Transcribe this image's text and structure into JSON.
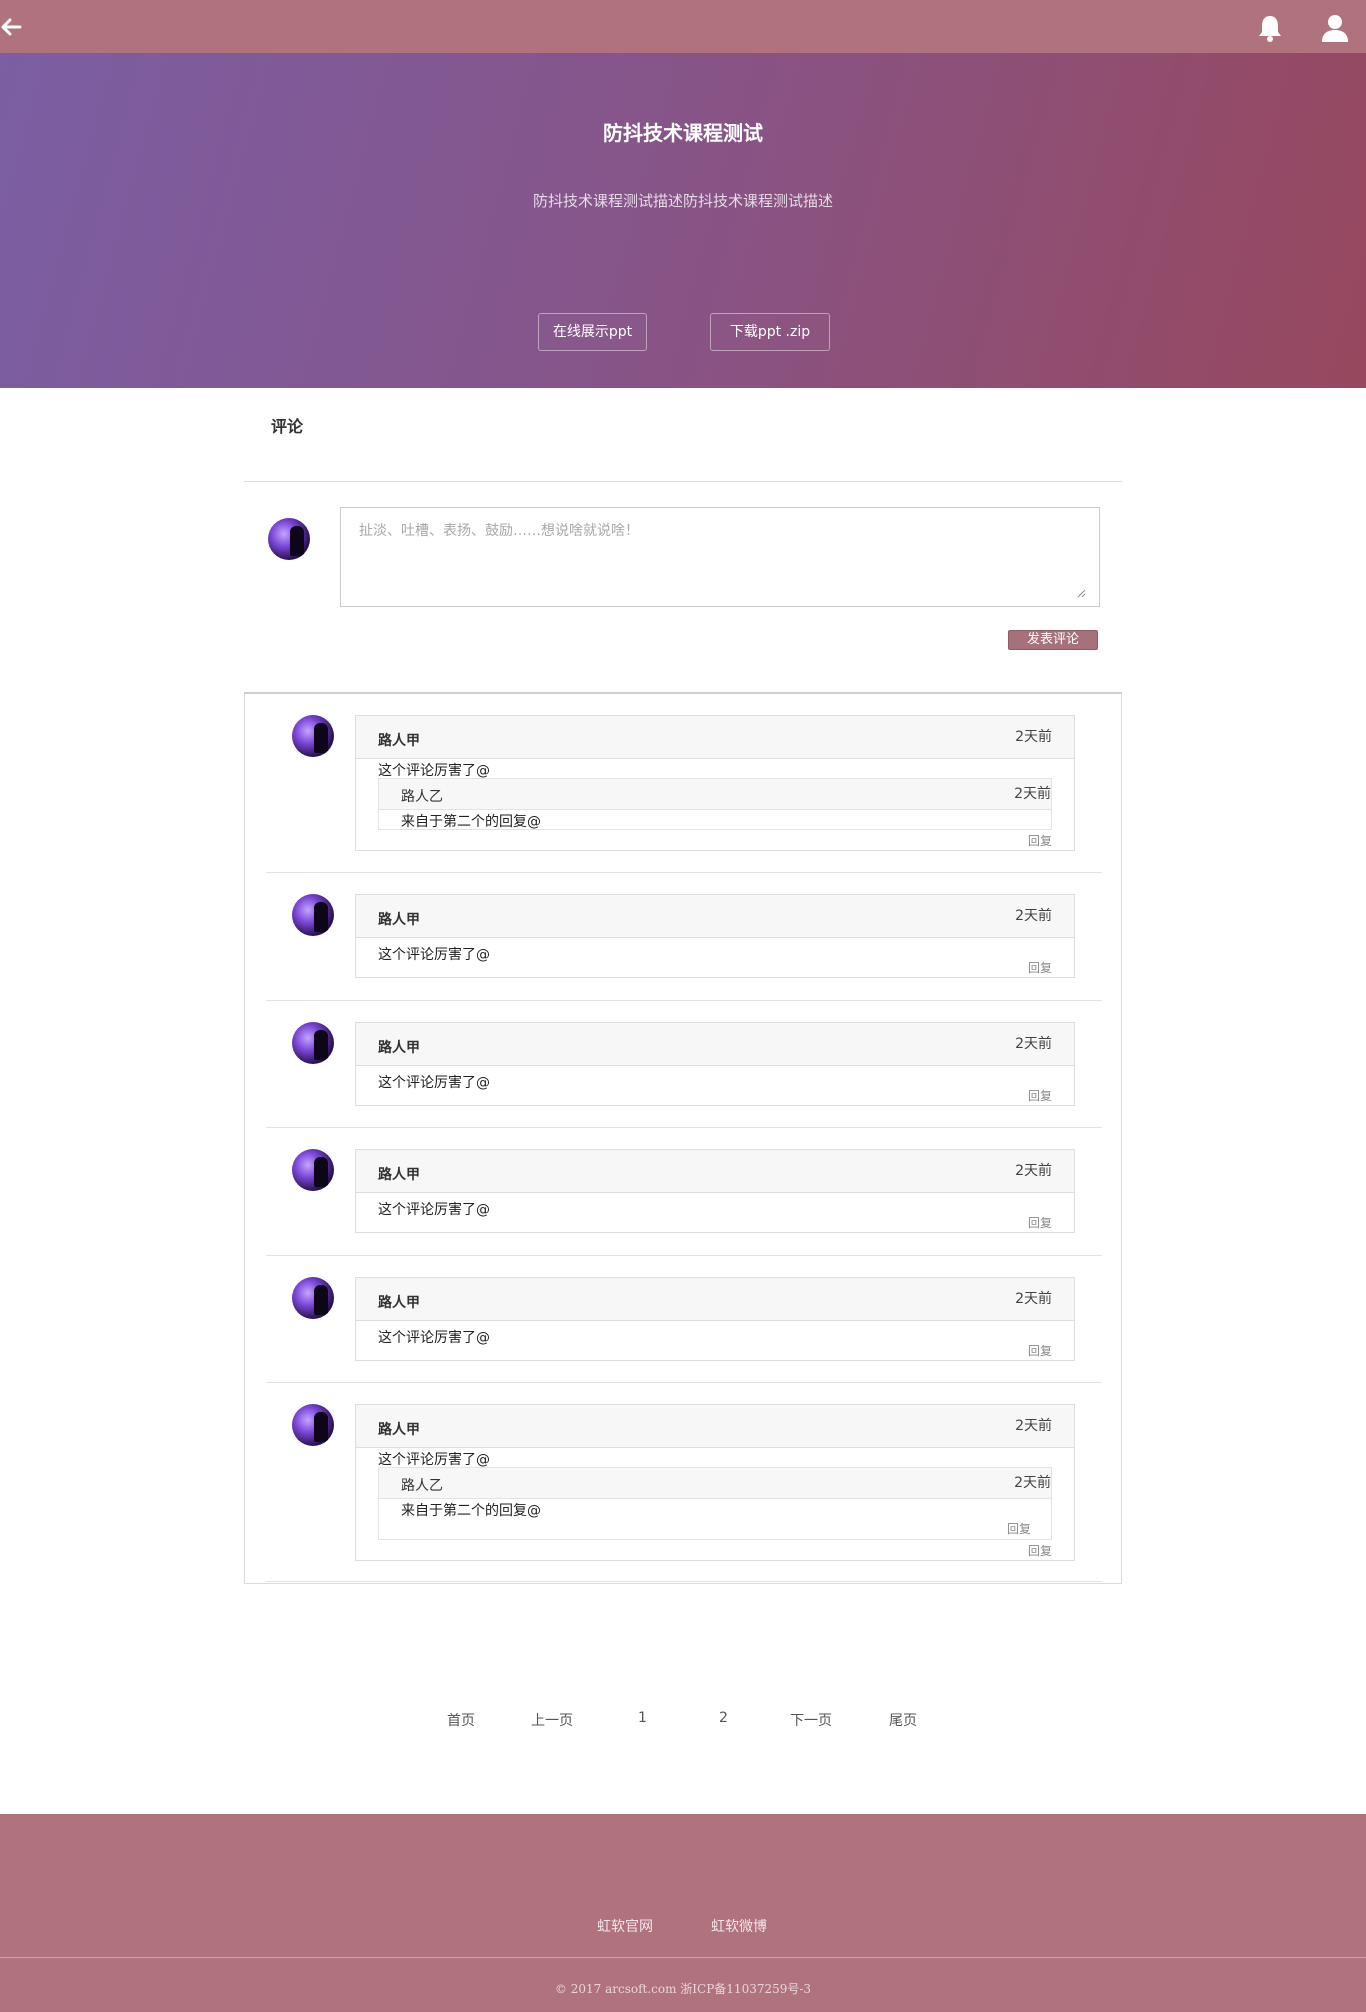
{
  "header": {
    "back_icon": "arrow-left-icon",
    "bell_icon": "bell-icon",
    "user_icon": "user-icon"
  },
  "hero": {
    "title": "防抖技术课程测试",
    "description": "防抖技术课程测试描述防抖技术课程测试描述",
    "btn_online": "在线展示ppt",
    "btn_download": "下载ppt .zip"
  },
  "comments": {
    "section_title": "评论",
    "placeholder": "扯淡、吐槽、表扬、鼓励……想说啥就说啥！",
    "submit_label": "发表评论",
    "items": [
      {
        "name": "路人甲",
        "time": "2天前",
        "text": "这个评论厉害了@",
        "reply": "回复",
        "sub": {
          "name": "路人乙",
          "time": "2天前",
          "text": "来自于第二个的回复@"
        }
      },
      {
        "name": "路人甲",
        "time": "2天前",
        "text": "这个评论厉害了@",
        "reply": "回复"
      },
      {
        "name": "路人甲",
        "time": "2天前",
        "text": "这个评论厉害了@",
        "reply": "回复"
      },
      {
        "name": "路人甲",
        "time": "2天前",
        "text": "这个评论厉害了@",
        "reply": "回复"
      },
      {
        "name": "路人甲",
        "time": "2天前",
        "text": "这个评论厉害了@",
        "reply": "回复"
      },
      {
        "name": "路人甲",
        "time": "2天前",
        "text": "这个评论厉害了@",
        "reply": "回复",
        "sub": {
          "name": "路人乙",
          "time": "2天前",
          "text": "来自于第二个的回复@",
          "reply": "回复"
        }
      }
    ]
  },
  "pagination": {
    "first": "首页",
    "prev": "上一页",
    "page1": "1",
    "page2": "2",
    "next": "下一页",
    "last": "尾页"
  },
  "footer": {
    "link1": "虹软官网",
    "link2": "虹软微博",
    "copyright": "© 2017 arcsoft.com  浙ICP备11037259号-3"
  },
  "colors": {
    "topbar": "#b0727c",
    "hero_start": "#7b5ea3",
    "hero_end": "#97485e",
    "button": "#a6717a"
  }
}
